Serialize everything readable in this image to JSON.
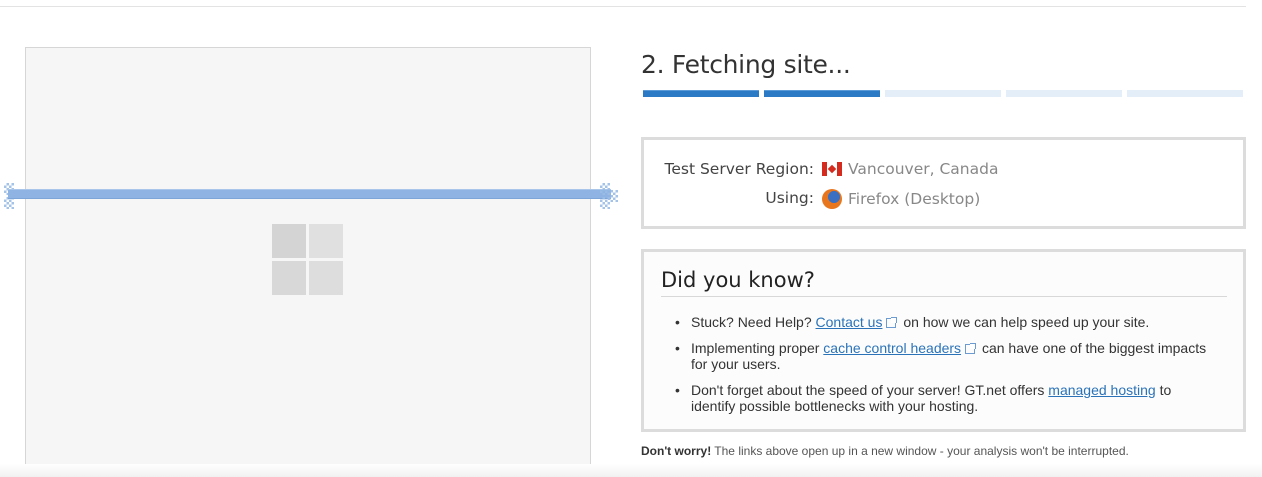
{
  "status": {
    "step_title": "2. Fetching site...",
    "progress": {
      "total_steps": 5,
      "completed_steps": 2
    }
  },
  "server": {
    "region_label": "Test Server Region:",
    "region_value": "Vancouver, Canada",
    "region_icon": "canada-flag-icon",
    "using_label": "Using:",
    "using_value": "Firefox (Desktop)",
    "using_icon": "firefox-icon"
  },
  "tips": {
    "title": "Did you know?",
    "items": [
      {
        "before": "Stuck? Need Help? ",
        "link": "Contact us",
        "after": " on how we can help speed up your site."
      },
      {
        "before": "Implementing proper ",
        "link": "cache control headers",
        "after": " can have one of the biggest impacts for your users."
      },
      {
        "before": "Don't forget about the speed of your server! GT.net offers ",
        "link": "managed hosting",
        "after": " to identify possible bottlenecks with your hosting."
      }
    ]
  },
  "footnote": {
    "bold": "Don't worry!",
    "text": " The links above open up in a new window - your analysis won't be interrupted."
  },
  "colors": {
    "progress_done": "#2a7ac6",
    "progress_pending": "#e4eef8",
    "link": "#2b73b8",
    "scan_line": "#8fb3e2"
  }
}
